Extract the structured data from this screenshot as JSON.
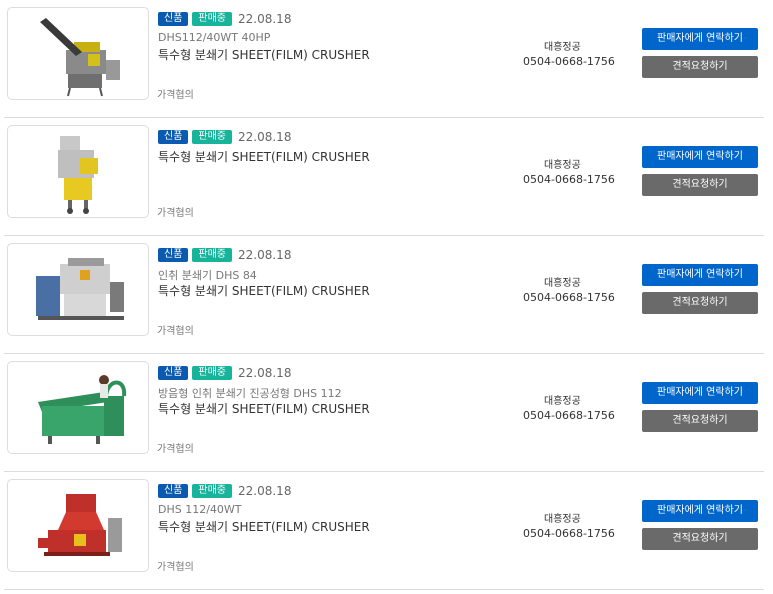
{
  "products": [
    {
      "badge_new": "신품",
      "badge_status": "판매중",
      "date": "22.08.18",
      "subtitle": "DHS112/40WT 40HP",
      "title": "특수형 분쇄기 SHEET(FILM) CRUSHER",
      "price": "가격협의",
      "seller_name": "대흥정공",
      "seller_phone": "0504-0668-1756",
      "contact_label": "판매자에게 연락하기",
      "quote_label": "견적요청하기"
    },
    {
      "badge_new": "신품",
      "badge_status": "판매중",
      "date": "22.08.18",
      "subtitle": "",
      "title": "특수형 분쇄기 SHEET(FILM) CRUSHER",
      "price": "가격협의",
      "seller_name": "대흥정공",
      "seller_phone": "0504-0668-1756",
      "contact_label": "판매자에게 연락하기",
      "quote_label": "견적요청하기"
    },
    {
      "badge_new": "신품",
      "badge_status": "판매중",
      "date": "22.08.18",
      "subtitle": "인취 분쇄기 DHS 84",
      "title": "특수형 분쇄기 SHEET(FILM) CRUSHER",
      "price": "가격협의",
      "seller_name": "대흥정공",
      "seller_phone": "0504-0668-1756",
      "contact_label": "판매자에게 연락하기",
      "quote_label": "견적요청하기"
    },
    {
      "badge_new": "신품",
      "badge_status": "판매중",
      "date": "22.08.18",
      "subtitle": "방음형 인취 분쇄기 진공성형 DHS 112",
      "title": "특수형 분쇄기 SHEET(FILM) CRUSHER",
      "price": "가격협의",
      "seller_name": "대흥정공",
      "seller_phone": "0504-0668-1756",
      "contact_label": "판매자에게 연락하기",
      "quote_label": "견적요청하기"
    },
    {
      "badge_new": "신품",
      "badge_status": "판매중",
      "date": "22.08.18",
      "subtitle": "DHS 112/40WT",
      "title": "특수형 분쇄기 SHEET(FILM) CRUSHER",
      "price": "가격협의",
      "seller_name": "대흥정공",
      "seller_phone": "0504-0668-1756",
      "contact_label": "판매자에게 연락하기",
      "quote_label": "견적요청하기"
    }
  ],
  "colors": {
    "badge_new": "#0a5ab0",
    "badge_sale": "#17b49b",
    "contact_button": "#0066cc",
    "quote_button": "#6a6a6a"
  }
}
